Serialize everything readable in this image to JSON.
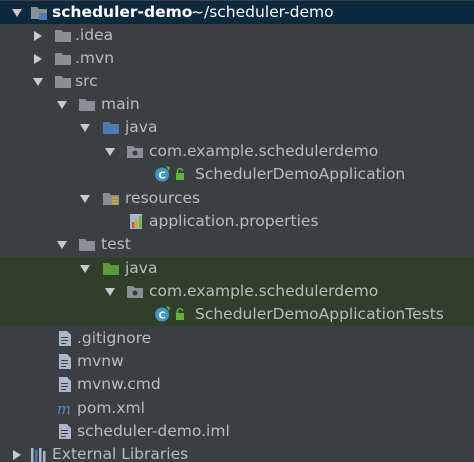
{
  "project_tree": {
    "root": {
      "name": "scheduler-demo",
      "path": "~/scheduler-demo"
    },
    "items": [
      {
        "label": ".idea"
      },
      {
        "label": ".mvn"
      },
      {
        "label": "src"
      },
      {
        "label": "main"
      },
      {
        "label": "java"
      },
      {
        "label": "com.example.schedulerdemo"
      },
      {
        "label": "SchedulerDemoApplication"
      },
      {
        "label": "resources"
      },
      {
        "label": "application.properties"
      },
      {
        "label": "test"
      },
      {
        "label": "java"
      },
      {
        "label": "com.example.schedulerdemo"
      },
      {
        "label": "SchedulerDemoApplicationTests"
      },
      {
        "label": ".gitignore"
      },
      {
        "label": "mvnw"
      },
      {
        "label": "mvnw.cmd"
      },
      {
        "label": "pom.xml"
      },
      {
        "label": "scheduler-demo.iml"
      },
      {
        "label": "External Libraries"
      }
    ]
  },
  "colors": {
    "background": "#3c3f41",
    "selection": "#0d293e",
    "test_highlight": "#313f2a",
    "source_folder": "#4a7bb3",
    "test_folder": "#5a9a3a",
    "folder": "#8a8f95",
    "class_icon": "#3d97c9"
  }
}
